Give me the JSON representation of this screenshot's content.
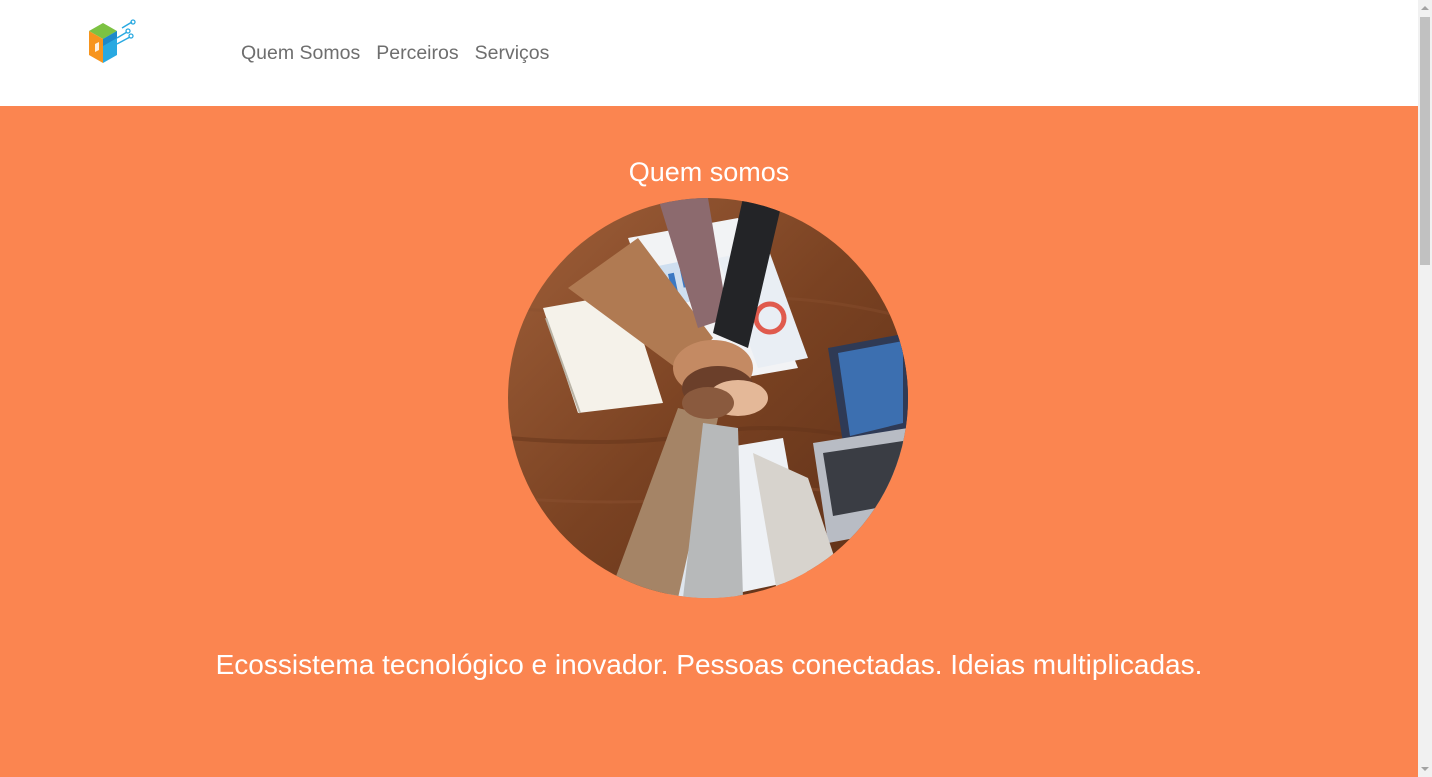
{
  "header": {
    "logo_icon": "cube-circuit-logo-icon",
    "nav": [
      {
        "label": "Quem Somos"
      },
      {
        "label": "Perceiros"
      },
      {
        "label": "Serviços"
      }
    ]
  },
  "hero": {
    "title": "Quem somos",
    "image_icon": "team-hands-photo",
    "tagline": "Ecossistema tecnológico e inovador. Pessoas conectadas. Ideias multiplicadas."
  },
  "colors": {
    "accent": "#fb8550",
    "nav_text": "#6e6e6e",
    "hero_text": "#ffffff"
  }
}
